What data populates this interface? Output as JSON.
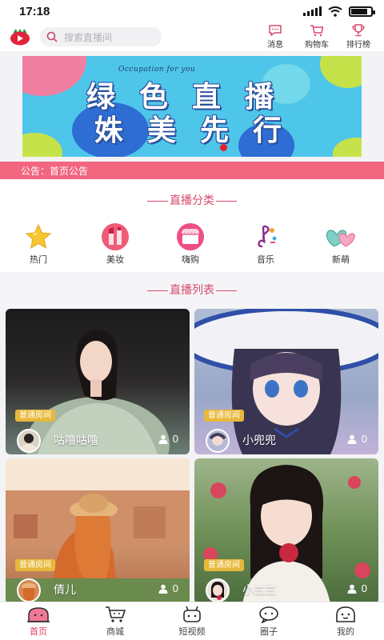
{
  "status_bar": {
    "time": "17:18",
    "battery_level": 0.85
  },
  "header": {
    "search_placeholder": "搜索直播间",
    "actions": [
      {
        "label": "消息",
        "icon": "message-icon"
      },
      {
        "label": "购物车",
        "icon": "cart-icon"
      },
      {
        "label": "排行榜",
        "icon": "trophy-icon"
      }
    ]
  },
  "banner": {
    "subtitle": "Occupation for you",
    "line1": "绿色直播",
    "line2": "姝美先行",
    "accent_color": "#4ec6e9"
  },
  "notice": {
    "text": "公告：首页公告"
  },
  "categories": {
    "title": "直播分类",
    "items": [
      {
        "label": "热门",
        "icon": "star-icon"
      },
      {
        "label": "美妆",
        "icon": "lipstick-icon"
      },
      {
        "label": "嗨购",
        "icon": "shop-icon"
      },
      {
        "label": "音乐",
        "icon": "music-icon"
      },
      {
        "label": "新萌",
        "icon": "hearts-icon"
      }
    ]
  },
  "live_list": {
    "title": "直播列表",
    "rooms": [
      {
        "badge": "普通房间",
        "name": "咕噜咕噜",
        "viewers": "0"
      },
      {
        "badge": "普通房间",
        "name": "小兜兜",
        "viewers": "0"
      },
      {
        "badge": "普通房间",
        "name": "倩儿",
        "viewers": "0"
      },
      {
        "badge": "普通房间",
        "name": "小兰兰",
        "viewers": "0"
      }
    ]
  },
  "bottom_nav": {
    "items": [
      {
        "label": "首页",
        "icon": "home-icon",
        "active": true
      },
      {
        "label": "商城",
        "icon": "mall-icon",
        "active": false
      },
      {
        "label": "短视频",
        "icon": "video-icon",
        "active": false
      },
      {
        "label": "圈子",
        "icon": "circle-icon",
        "active": false
      },
      {
        "label": "我的",
        "icon": "profile-icon",
        "active": false
      }
    ]
  },
  "colors": {
    "brand_pink": "#f2667f",
    "title_pink": "#d8486b",
    "badge_gold": "#e8b83a",
    "active_nav": "#e13a62"
  }
}
